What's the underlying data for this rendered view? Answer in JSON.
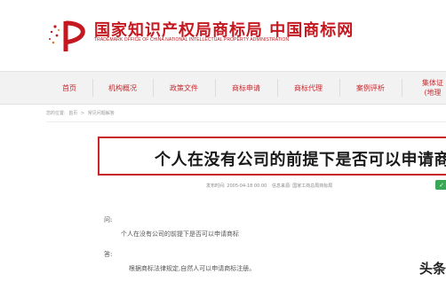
{
  "header": {
    "title": "国家知识产权局商标局 中国商标网",
    "subtitle": "TRADEMARK OFFICE OF CHINA NATIONAL INTELLECTUAL PROPERTY ADMINISTRATION",
    "logo_icon": "cnipa-logo-icon",
    "brand_color": "#c41920"
  },
  "nav": {
    "items": [
      {
        "label": "首页"
      },
      {
        "label": "机构概况"
      },
      {
        "label": "政策文件"
      },
      {
        "label": "商标申请"
      },
      {
        "label": "商标代理"
      },
      {
        "label": "案例评析"
      },
      {
        "label_line1": "集体证",
        "label_line2": "(地理"
      }
    ]
  },
  "breadcrumb": {
    "items": [
      "您的位置:",
      "首页",
      ">",
      "常见问题解答"
    ]
  },
  "article": {
    "title": "个人在没有公司的前提下是否可以申请商标",
    "published": "发布时间: 2005-04-18 00:00",
    "source": "信息来源: 国家工商总局商标局",
    "q_label": "问:",
    "question": "个人在没有公司的前提下是否可以申请商标",
    "a_label": "答:",
    "answer": "根据商标法律规定,自然人可以申请商标注册。"
  },
  "badge": {
    "icon": "wechat-share-icon"
  },
  "watermark": "头条"
}
